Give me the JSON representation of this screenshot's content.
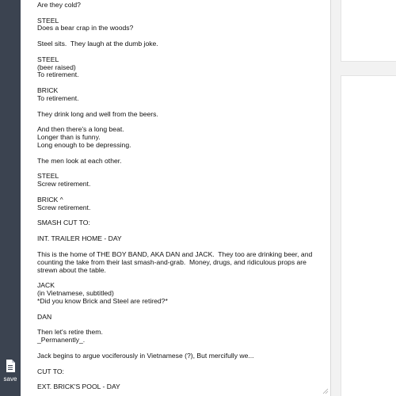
{
  "sidebar": {
    "save_label": "save"
  },
  "editor": {
    "script_text": "BRICK\nAre they cold?\n\nSTEEL\nDoes a bear crap in the woods?\n\nSteel sits.  They laugh at the dumb joke.\n\nSTEEL\n(beer raised)\nTo retirement.\n\nBRICK\nTo retirement.\n\nThey drink long and well from the beers.\n\nAnd then there's a long beat.\nLonger than is funny.\nLong enough to be depressing.\n\nThe men look at each other.\n\nSTEEL\nScrew retirement.\n\nBRICK ^\nScrew retirement.\n\nSMASH CUT TO:\n\nINT. TRAILER HOME - DAY\n\nThis is the home of THE BOY BAND, AKA DAN and JACK.  They too are drinking beer, and counting the take from their last smash-and-grab.  Money, drugs, and ridiculous props are strewn about the table.\n\nJACK\n(in Vietnamese, subtitled)\n*Did you know Brick and Steel are retired?*\n\nDAN\n\nThen let's retire them.\n_Permanently_.\n\nJack begins to argue vociferously in Vietnamese (?), But mercifully we...\n\nCUT TO:\n\nEXT. BRICK'S POOL - DAY"
  },
  "icons": {
    "save": "document-icon",
    "resize": "resize-grip-icon"
  },
  "colors": {
    "sidebar_bg": "#3b4350",
    "page_bg": "#f2f2f2",
    "editor_bg": "#ffffff",
    "text": "#111111"
  }
}
